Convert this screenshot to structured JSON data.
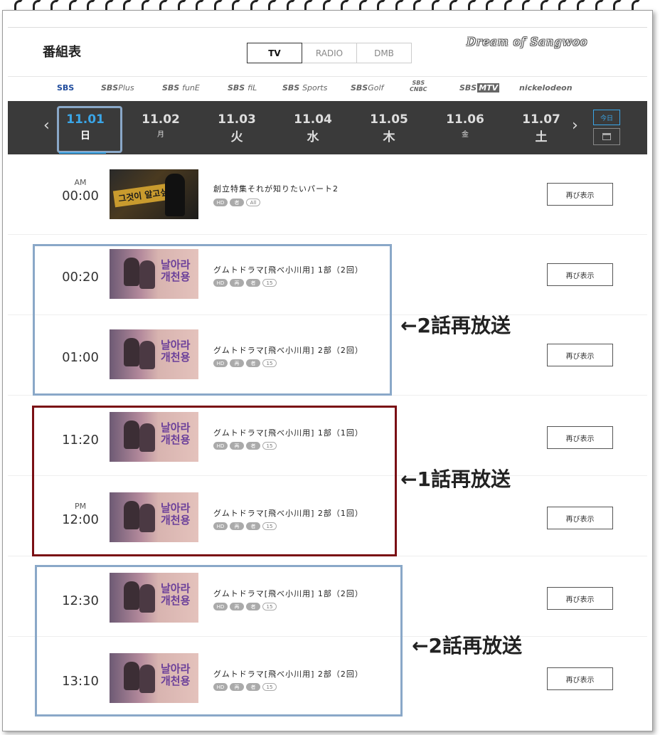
{
  "header": {
    "title": "番組表",
    "media_tabs": [
      "TV",
      "RADIO",
      "DMB"
    ],
    "watermark": "Dream of Sangwoo"
  },
  "channels": [
    {
      "main": "SBS",
      "sub": ""
    },
    {
      "main": "SBS",
      "sub": "Plus"
    },
    {
      "main": "SBS",
      "sub": "funE"
    },
    {
      "main": "SBS",
      "sub": "fiL"
    },
    {
      "main": "SBS",
      "sub": "Sports"
    },
    {
      "main": "SBS",
      "sub": "Golf"
    },
    {
      "main": "SBS",
      "sub": "CNBC"
    },
    {
      "main": "SBS",
      "sub": "MTV"
    },
    {
      "main": "nickelodeon",
      "sub": ""
    }
  ],
  "dates": [
    {
      "date": "11.01",
      "weekday": "日"
    },
    {
      "date": "11.02",
      "weekday": "月"
    },
    {
      "date": "11.03",
      "weekday": "火"
    },
    {
      "date": "11.04",
      "weekday": "水"
    },
    {
      "date": "11.05",
      "weekday": "木"
    },
    {
      "date": "11.06",
      "weekday": "金"
    },
    {
      "date": "11.07",
      "weekday": "土"
    }
  ],
  "date_nav": {
    "prev": "‹",
    "next": "›",
    "today": "今日"
  },
  "schedule": [
    {
      "ampm": "AM",
      "time": "00:00",
      "title": "創立特集それが知りたいパート2",
      "badges": [
        "HD",
        "者",
        "All"
      ],
      "button": "再び表示",
      "thumb_text": "그것이 알고싶다"
    },
    {
      "ampm": "",
      "time": "00:20",
      "title": "グムトドラマ[飛べ小川用] 1部（2回）",
      "badges": [
        "HD",
        "再",
        "者",
        "15"
      ],
      "button": "再び表示",
      "thumb_text": "날아라 개천용"
    },
    {
      "ampm": "",
      "time": "01:00",
      "title": "グムトドラマ[飛べ小川用] 2部（2回）",
      "badges": [
        "HD",
        "再",
        "者",
        "15"
      ],
      "button": "再び表示",
      "thumb_text": "날아라 개천용"
    },
    {
      "ampm": "",
      "time": "11:20",
      "title": "グムトドラマ[飛べ小川用] 1部（1回）",
      "badges": [
        "HD",
        "再",
        "者",
        "15"
      ],
      "button": "再び表示",
      "thumb_text": "날아라 개천용"
    },
    {
      "ampm": "PM",
      "time": "12:00",
      "title": "グムトドラマ[飛べ小川用] 2部（1回）",
      "badges": [
        "HD",
        "再",
        "者",
        "15"
      ],
      "button": "再び表示",
      "thumb_text": "날아라 개천용"
    },
    {
      "ampm": "",
      "time": "12:30",
      "title": "グムトドラマ[飛べ小川用] 1部（2回）",
      "badges": [
        "HD",
        "再",
        "者",
        "15"
      ],
      "button": "再び表示",
      "thumb_text": "날아라 개천용"
    },
    {
      "ampm": "",
      "time": "13:10",
      "title": "グムトドラマ[飛べ小川用] 2部（2回）",
      "badges": [
        "HD",
        "再",
        "者",
        "15"
      ],
      "button": "再び表示",
      "thumb_text": "날아라 개천용"
    }
  ],
  "annotations": [
    "←2話再放送",
    "←1話再放送",
    "←2話再放送"
  ],
  "colors": {
    "accent": "#3aa6e8",
    "highlight_blue": "#8aa8c8",
    "highlight_red": "#7a0f14",
    "datebar": "#3a3a3a"
  }
}
